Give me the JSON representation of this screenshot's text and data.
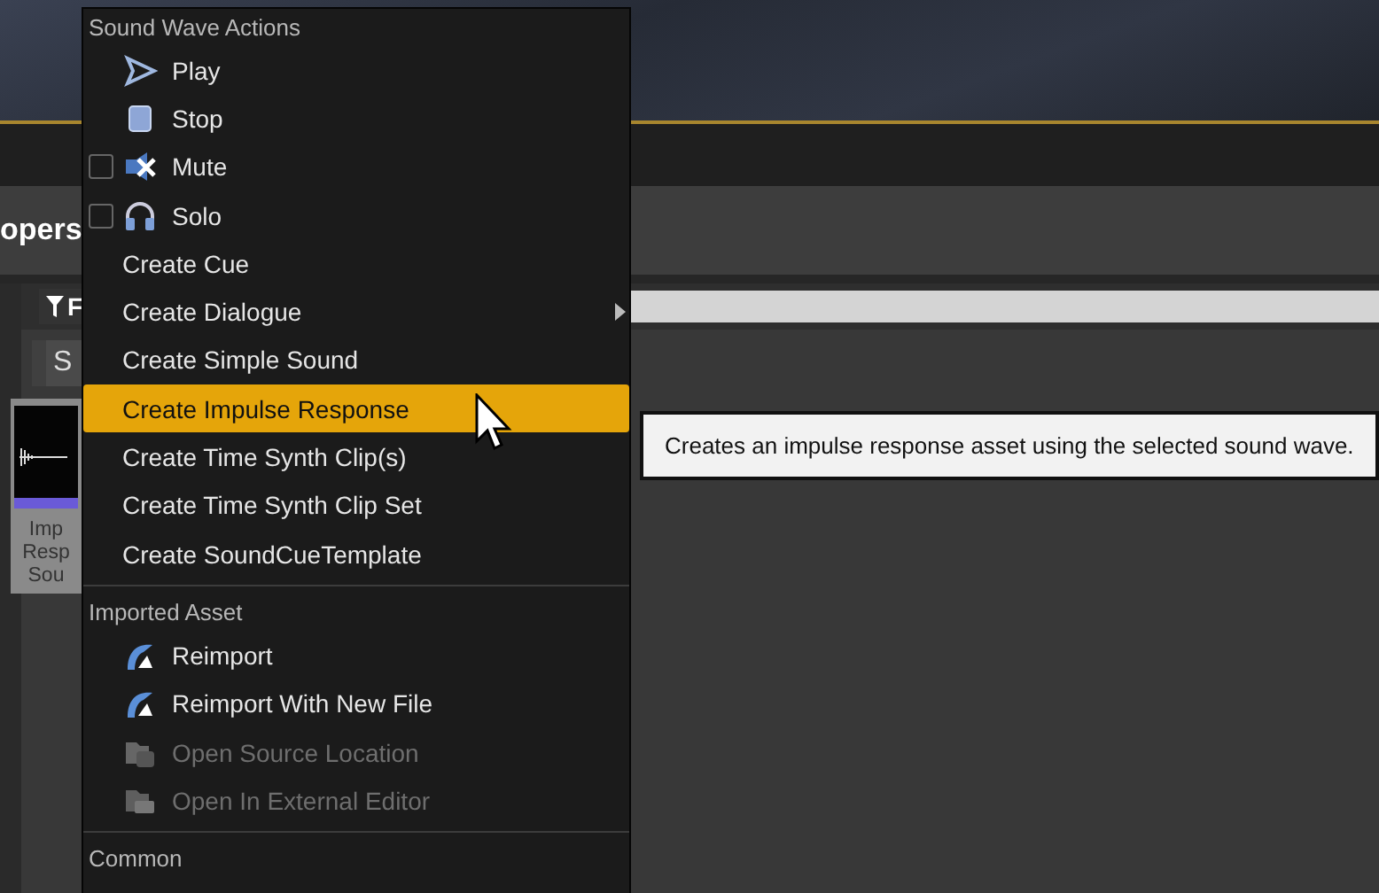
{
  "background": {
    "panel_title": "opers",
    "filter_label": "F",
    "button_label": "S",
    "asset_label_lines": [
      "Imp",
      "Resp",
      "Sou"
    ]
  },
  "context_menu": {
    "sections": [
      {
        "title": "Sound Wave Actions",
        "items": [
          {
            "label": "Play",
            "kind": "play",
            "selected": false,
            "disabled": false
          },
          {
            "label": "Stop",
            "kind": "stop",
            "selected": false,
            "disabled": false
          },
          {
            "label": "Mute",
            "kind": "mute",
            "checked": false,
            "selected": false,
            "disabled": false
          },
          {
            "label": "Solo",
            "kind": "solo",
            "checked": false,
            "selected": false,
            "disabled": false
          },
          {
            "label": "Create Cue",
            "kind": "text",
            "selected": false,
            "disabled": false
          },
          {
            "label": "Create Dialogue",
            "kind": "submenu",
            "selected": false,
            "disabled": false
          },
          {
            "label": "Create Simple Sound",
            "kind": "text",
            "selected": false,
            "disabled": false
          },
          {
            "label": "Create Impulse Response",
            "kind": "text",
            "selected": true,
            "disabled": false
          },
          {
            "label": "Create Time Synth Clip(s)",
            "kind": "text",
            "selected": false,
            "disabled": false
          },
          {
            "label": "Create Time Synth Clip Set",
            "kind": "text",
            "selected": false,
            "disabled": false
          },
          {
            "label": "Create SoundCueTemplate",
            "kind": "text",
            "selected": false,
            "disabled": false
          }
        ]
      },
      {
        "title": "Imported Asset",
        "items": [
          {
            "label": "Reimport",
            "kind": "reimport",
            "selected": false,
            "disabled": false
          },
          {
            "label": "Reimport With New File",
            "kind": "reimport",
            "selected": false,
            "disabled": false
          },
          {
            "label": "Open Source Location",
            "kind": "folder",
            "selected": false,
            "disabled": true
          },
          {
            "label": "Open In External Editor",
            "kind": "external",
            "selected": false,
            "disabled": true
          }
        ]
      },
      {
        "title": "Common"
      }
    ]
  },
  "tooltip": {
    "text": "Creates an impulse response asset using the selected sound wave."
  }
}
